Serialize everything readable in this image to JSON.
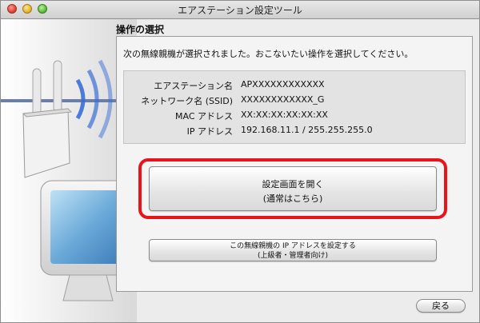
{
  "window": {
    "title": "エアステーション設定ツール"
  },
  "section": {
    "title": "操作の選択"
  },
  "instruction": "次の無線親機が選択されました。おこないたい操作を選択してください。",
  "info": [
    {
      "label": "エアステーション名",
      "value": "APXXXXXXXXXXXX"
    },
    {
      "label": "ネットワーク名 (SSID)",
      "value": "XXXXXXXXXXXX_G"
    },
    {
      "label": "MAC アドレス",
      "value": "XX:XX:XX:XX:XX:XX"
    },
    {
      "label": "IP アドレス",
      "value": "192.168.11.1 / 255.255.255.0"
    }
  ],
  "buttons": {
    "open_settings": {
      "line1": "設定画面を開く",
      "line2": "(通常はこちら)"
    },
    "set_ip": {
      "line1": "この無線親機の IP アドレスを設定する",
      "line2": "(上級者・管理者向け)"
    },
    "back": "戻る"
  },
  "colors": {
    "highlight": "#e8141c",
    "wave": "#3a6fd8"
  }
}
